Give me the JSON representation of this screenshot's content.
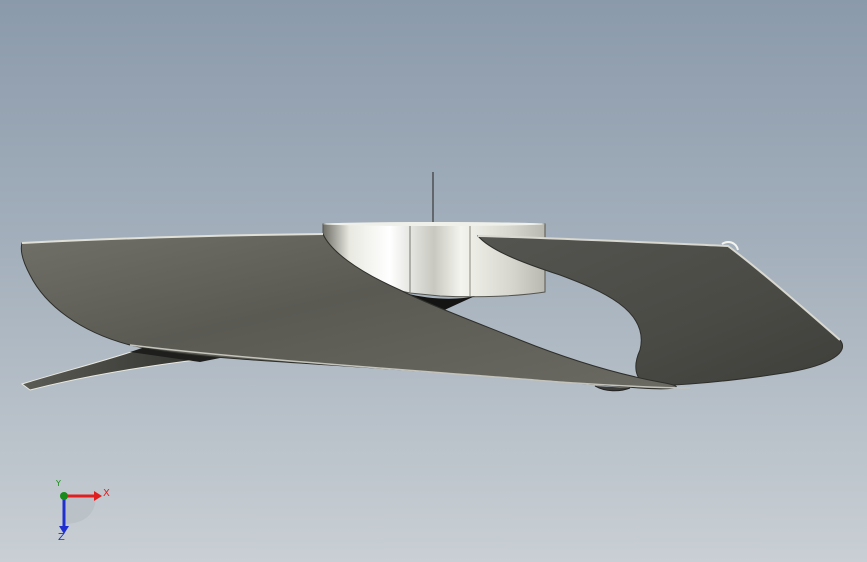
{
  "scene": {
    "model": "propeller",
    "background_top": "#8b9aab",
    "background_bottom": "#c9cfd4"
  },
  "triad": {
    "x_label": "X",
    "y_label": "Y",
    "z_label": "Z",
    "x_color": "#e02020",
    "y_color": "#1a8a1a",
    "z_color": "#2030d0"
  }
}
